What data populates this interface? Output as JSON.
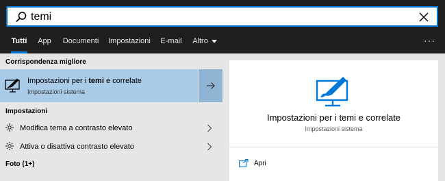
{
  "search": {
    "value": "temi",
    "placeholder": ""
  },
  "tabs": [
    {
      "label": "Tutti",
      "active": true
    },
    {
      "label": "App"
    },
    {
      "label": "Documenti"
    },
    {
      "label": "Impostazioni"
    },
    {
      "label": "E-mail"
    },
    {
      "label": "Altro"
    }
  ],
  "more_label": "···",
  "sections": {
    "best_match": "Corrispondenza migliore",
    "settings": "Impostazioni",
    "photos": "Foto (1+)"
  },
  "best_match": {
    "title_before": "Impostazioni per i ",
    "title_bold": "temi",
    "title_after": " e correlate",
    "subtitle": "Impostazioni sistema",
    "icon": "personalization-monitor-icon"
  },
  "settings_items": [
    {
      "label": "Modifica tema a contrasto elevato",
      "icon": "sun-brightness-icon"
    },
    {
      "label": "Attiva o disattiva contrasto elevato",
      "icon": "sun-brightness-icon"
    }
  ],
  "preview": {
    "title": "Impostazioni per i temi e correlate",
    "subtitle": "Impostazioni sistema",
    "open_label": "Apri"
  },
  "colors": {
    "accent": "#0078d7",
    "topbar_bg": "#1f1f1f",
    "selected_bg": "#a9cbe8",
    "pane_bg": "#e6e6e6"
  }
}
